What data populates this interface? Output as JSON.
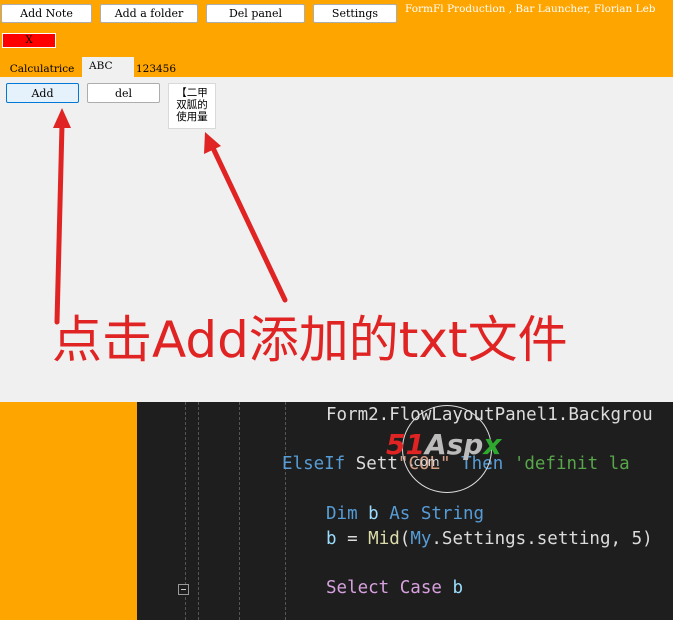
{
  "toolbar": {
    "add_note": "Add Note",
    "add_folder": "Add a folder",
    "del_panel": "Del panel",
    "settings": "Settings",
    "credit": "FormFl Production , Bar Launcher, Florian Leb",
    "close": "X"
  },
  "tabs": [
    {
      "label": "Calculatrice"
    },
    {
      "label": "ABC"
    },
    {
      "label": "123456"
    }
  ],
  "panel": {
    "add_button": "Add",
    "del_button": "del",
    "file_item_lines": [
      "【二甲",
      "双胍的",
      "使用量"
    ]
  },
  "annotation": {
    "text": "点击Add添加的txt文件",
    "color": "#e02424"
  },
  "code": {
    "line1": "Form2.FlowLayoutPanel1.Backgrou",
    "line2_kw": "ElseIf",
    "line2_a": " Sett",
    "line2_str": "\"COL\"",
    "line2_then": " Then ",
    "line2_comment": "'definit la",
    "line3_dim": "Dim",
    "line3_var": " b ",
    "line3_as": "As",
    "line3_type": " String",
    "line4_var": "b",
    "line4_eq": " = ",
    "line4_fn": "Mid",
    "line4_my": "My",
    "line4_rest": ".Settings.setting, 5)",
    "line5_select": "Select",
    "line5_case": " Case",
    "line5_var": " b"
  },
  "watermark": {
    "num": "51",
    "asp": "Asp",
    "x": "x",
    "com": ".com"
  }
}
